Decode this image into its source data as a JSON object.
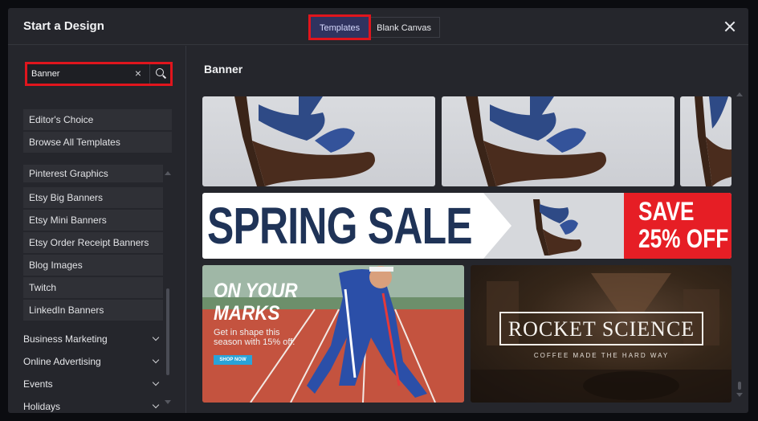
{
  "header": {
    "title": "Start a Design",
    "tabs": [
      {
        "label": "Templates",
        "active": true
      },
      {
        "label": "Blank Canvas",
        "active": false
      }
    ]
  },
  "sidebar": {
    "search": {
      "value": "Banner",
      "clear_glyph": "×"
    },
    "top_items": [
      {
        "label": "Editor's Choice"
      },
      {
        "label": "Browse All Templates"
      }
    ],
    "sub_items": [
      {
        "label": "Pinterest Graphics"
      },
      {
        "label": "Etsy Big Banners"
      },
      {
        "label": "Etsy Mini Banners"
      },
      {
        "label": "Etsy Order Receipt Banners"
      },
      {
        "label": "Blog Images"
      },
      {
        "label": "Twitch"
      },
      {
        "label": "LinkedIn Banners"
      }
    ],
    "groups": [
      {
        "label": "Business Marketing"
      },
      {
        "label": "Online Advertising"
      },
      {
        "label": "Events"
      },
      {
        "label": "Holidays"
      }
    ]
  },
  "main": {
    "title": "Banner",
    "spring": {
      "headline": "SPRING SALE",
      "save_line1": "SAVE",
      "save_line2": "25% OFF"
    },
    "marks": {
      "line1": "ON YOUR",
      "line2": "MARKS",
      "body": "Get in shape this season with 15% off.",
      "button": "SHOP NOW"
    },
    "rocket": {
      "title": "ROCKET SCIENCE",
      "subtitle": "COFFEE MADE THE HARD WAY"
    }
  },
  "colors": {
    "panel": "#25262c",
    "active_tab": "#30335f",
    "highlight": "#e0151d",
    "spring_navy": "#1f3357",
    "save_red": "#e61e25",
    "shoe_blue": "#2e4a86"
  }
}
